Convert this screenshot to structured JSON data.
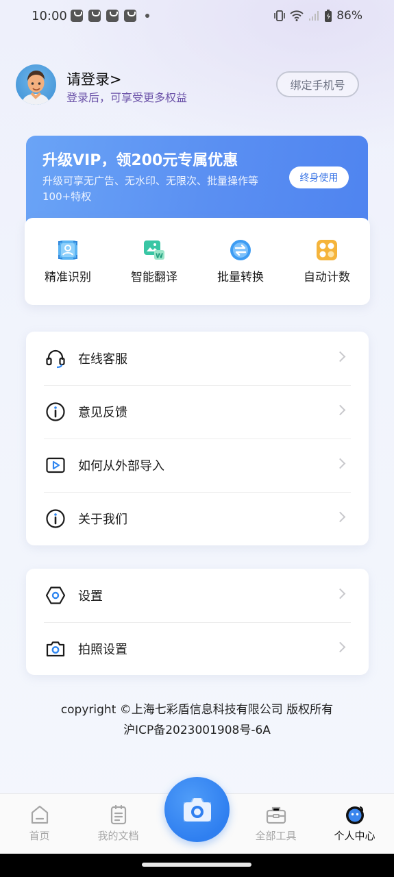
{
  "status_bar": {
    "time": "10:00",
    "battery": "86%",
    "icons": [
      "notification-bag-icon",
      "vibrate-icon",
      "wifi-icon",
      "signal-icon",
      "battery-icon"
    ]
  },
  "header": {
    "login_title": "请登录>",
    "login_subtitle": "登录后，可享受更多权益",
    "bind_phone": "绑定手机号"
  },
  "vip": {
    "title": "升级VIP，领200元专属优惠",
    "description": "升级可享无广告、无水印、无限次、批量操作等100+特权",
    "button": "终身使用",
    "colors": {
      "card_start": "#6aa4f6",
      "card_end": "#4f84f0"
    }
  },
  "tools": [
    {
      "label": "精准识别",
      "icon": "scan-portrait-icon"
    },
    {
      "label": "智能翻译",
      "icon": "translate-image-icon"
    },
    {
      "label": "批量转换",
      "icon": "batch-convert-icon"
    },
    {
      "label": "自动计数",
      "icon": "auto-count-icon"
    }
  ],
  "menu_primary": [
    {
      "label": "在线客服",
      "icon": "headset-icon"
    },
    {
      "label": "意见反馈",
      "icon": "info-circle-icon"
    },
    {
      "label": "如何从外部导入",
      "icon": "video-play-icon"
    },
    {
      "label": "关于我们",
      "icon": "info-circle-icon"
    }
  ],
  "menu_secondary": [
    {
      "label": "设置",
      "icon": "settings-hexagon-icon"
    },
    {
      "label": "拍照设置",
      "icon": "camera-icon"
    }
  ],
  "footer": {
    "copyright": "copyright ©上海七彩盾信息科技有限公司 版权所有",
    "icp": "沪ICP备2023001908号-6A"
  },
  "bottom_nav": [
    {
      "label": "首页",
      "icon": "home-icon",
      "active": false
    },
    {
      "label": "我的文档",
      "icon": "document-icon",
      "active": false
    },
    {
      "label": "全部工具",
      "icon": "toolbox-icon",
      "active": false
    },
    {
      "label": "个人中心",
      "icon": "profile-icon",
      "active": true
    }
  ],
  "accent_color": "#2f7ff0"
}
